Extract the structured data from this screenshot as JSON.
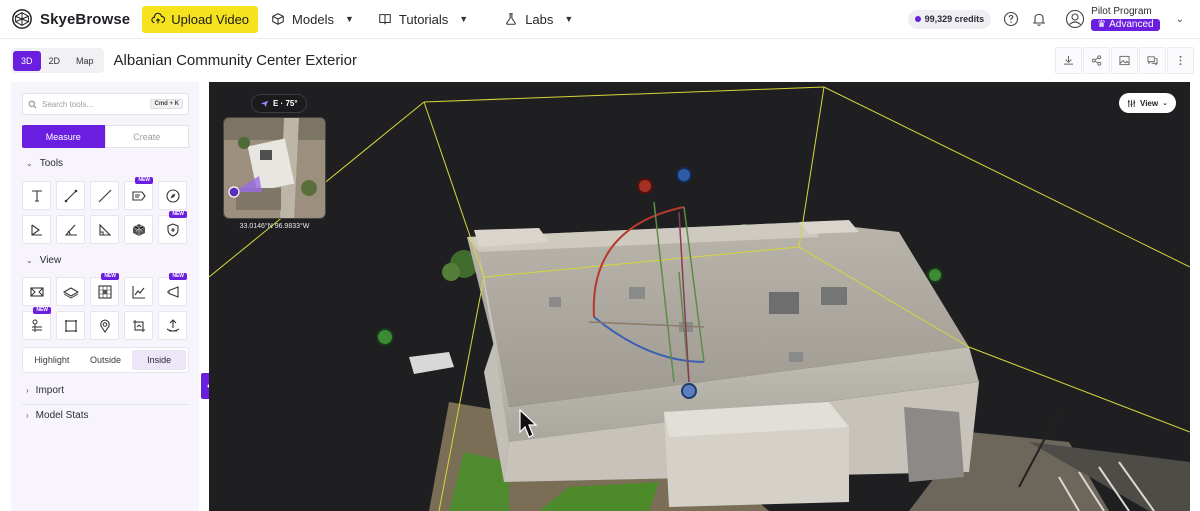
{
  "brand": {
    "name": "SkyeBrowse"
  },
  "nav": {
    "upload_label": "Upload Video",
    "models_label": "Models",
    "tutorials_label": "Tutorials",
    "labs_label": "Labs"
  },
  "account": {
    "credits": "99,329 credits",
    "plan_name": "Pilot Program",
    "plan_tier": "Advanced"
  },
  "view_modes": [
    "3D",
    "2D",
    "Map"
  ],
  "active_view_mode": "3D",
  "page_title": "Albanian Community Center Exterior",
  "sidebar": {
    "search_placeholder": "Search tools...",
    "search_shortcut": "Cmd + K",
    "tabs": [
      "Measure",
      "Create"
    ],
    "active_tab": "Measure",
    "sections": {
      "tools": "Tools",
      "view": "View",
      "import": "Import",
      "model_stats": "Model Stats"
    },
    "new_badge": "NEW",
    "tool_icons": [
      "text-tool-icon",
      "line-tool-icon",
      "segment-tool-icon",
      "label-tool-icon",
      "compass-tool-icon",
      "area-tool-icon",
      "angle-tool-icon",
      "height-tool-icon",
      "volume-tool-icon",
      "shield-tool-icon"
    ],
    "view_icons": [
      "box-clip-icon",
      "plane-clip-icon",
      "grid-icon",
      "profile-graph-icon",
      "camera-view-icon",
      "layers-icon",
      "frame-icon",
      "location-icon",
      "crop-icon",
      "ground-icon"
    ],
    "clip_modes": [
      "Highlight",
      "Outside",
      "Inside"
    ],
    "active_clip_mode": "Inside"
  },
  "viewport": {
    "compass_heading": "E · 75°",
    "coordinates": "33.0146°N 96.9833°W",
    "view_button_label": "View"
  },
  "colors": {
    "accent": "#6a1fe0",
    "upload_yellow": "#f6e31e",
    "bounding_box": "#d8d63a"
  }
}
